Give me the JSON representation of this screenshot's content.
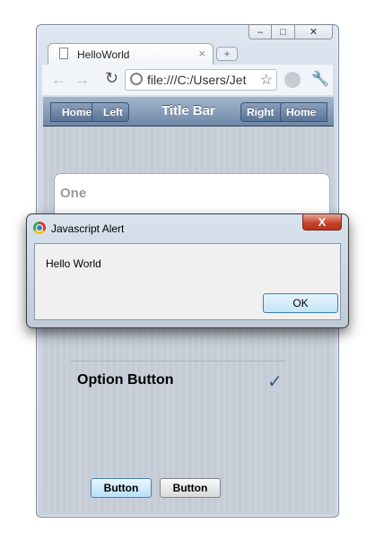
{
  "browser": {
    "tab": {
      "title": "HelloWorld",
      "close_glyph": "×"
    },
    "new_tab_glyph": "+",
    "window_buttons": [
      "–",
      "□",
      "✕"
    ],
    "address_bar": {
      "url": "file:///C:/Users/Jet"
    }
  },
  "titlebar": {
    "title": "Title Bar",
    "left_buttons": [
      "Home",
      "Left"
    ],
    "right_buttons": [
      "Right",
      "Home"
    ]
  },
  "content": {
    "card_label": "One",
    "option_label": "Option Button",
    "buttons": [
      "Button",
      "Button"
    ]
  },
  "alert": {
    "title": "Javascript Alert",
    "message": "Hello World",
    "ok_label": "OK",
    "close_glyph": "X"
  },
  "colors": {
    "titlebar": "#6f88a8",
    "close_button": "#c7452d",
    "checkmark": "#3b5b93"
  }
}
